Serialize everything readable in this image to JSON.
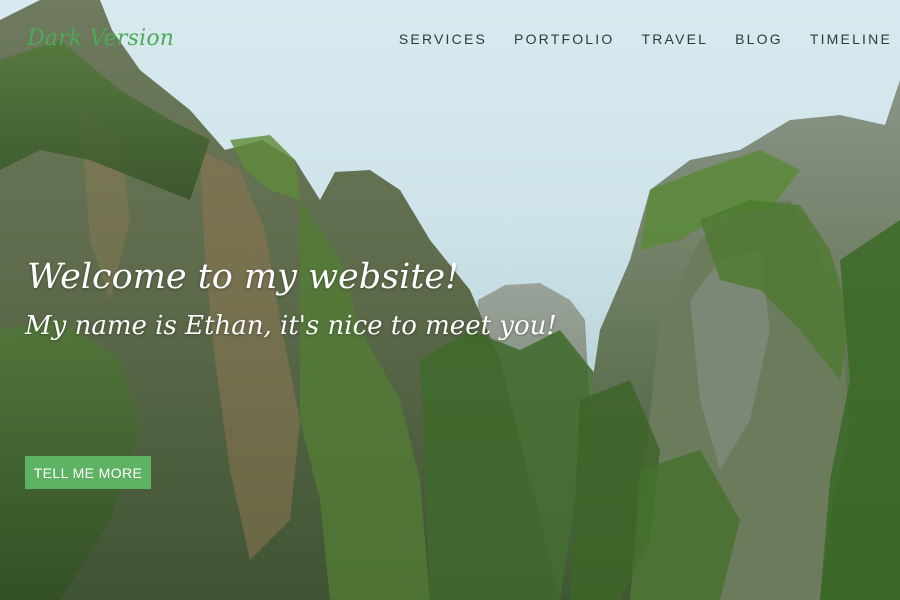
{
  "brand": {
    "name": "Dark Version",
    "color": "#4daa57"
  },
  "nav": {
    "items": [
      {
        "label": "SERVICES"
      },
      {
        "label": "PORTFOLIO"
      },
      {
        "label": "TRAVEL"
      },
      {
        "label": "BLOG"
      },
      {
        "label": "TIMELINE"
      }
    ]
  },
  "hero": {
    "title": "Welcome to my website!",
    "subtitle": "My name is Ethan, it's nice to meet you!",
    "button_label": "TELL ME MORE",
    "button_color": "#5db363",
    "background": "limestone-cliffs-photo"
  }
}
